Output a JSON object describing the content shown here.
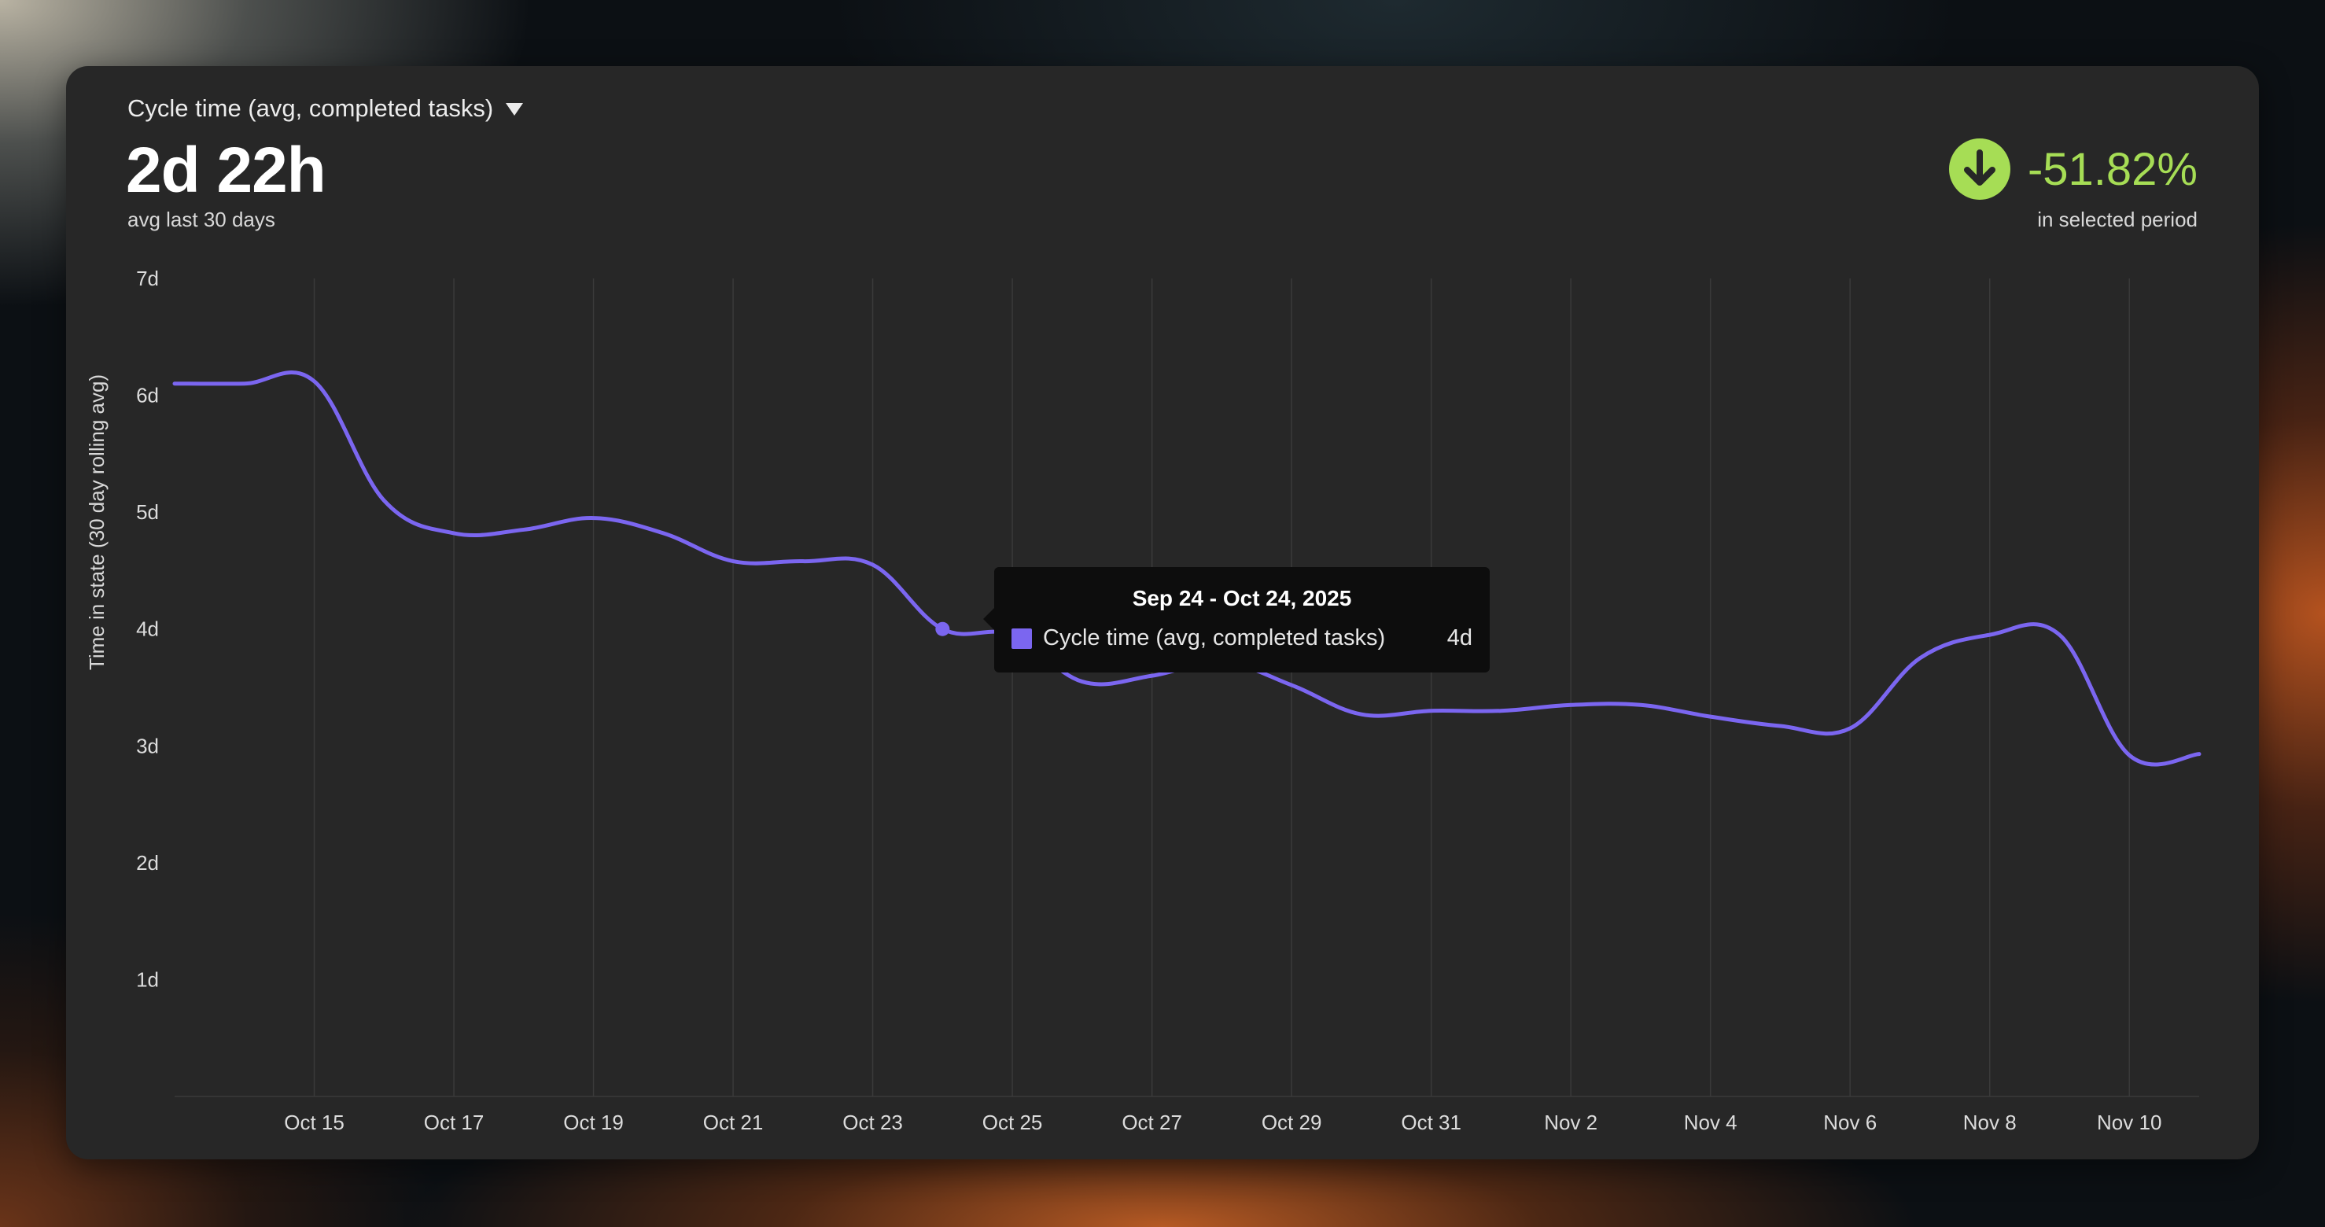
{
  "header": {
    "metric_selector": "Cycle time (avg, completed tasks)",
    "value": "2d 22h",
    "value_caption": "avg last 30 days",
    "change": "-51.82%",
    "change_caption": "in selected period"
  },
  "colors": {
    "series": "#7b66f0",
    "positive_change": "#a6dd55",
    "card_bg": "#272727"
  },
  "icons": {
    "metric_dropdown": "caret-down-icon",
    "change_indicator": "arrow-down-circle-icon"
  },
  "tooltip": {
    "title": "Sep 24 - Oct 24, 2025",
    "series_name": "Cycle time (avg, completed tasks)",
    "value": "4d"
  },
  "chart_data": {
    "type": "line",
    "ylabel": "Time in state (30 day rolling avg)",
    "ylim": [
      0,
      7
    ],
    "y_unit": "days",
    "yticks": [
      1,
      2,
      3,
      4,
      5,
      6,
      7
    ],
    "ytick_labels": [
      "1d",
      "2d",
      "3d",
      "4d",
      "5d",
      "6d",
      "7d"
    ],
    "xlim": [
      "2025-10-14",
      "2025-11-11"
    ],
    "xticks": [
      "2025-10-15",
      "2025-10-17",
      "2025-10-19",
      "2025-10-21",
      "2025-10-23",
      "2025-10-25",
      "2025-10-27",
      "2025-10-29",
      "2025-10-31",
      "2025-11-02",
      "2025-11-04",
      "2025-11-06",
      "2025-11-08",
      "2025-11-10"
    ],
    "xtick_labels": [
      "Oct 15",
      "Oct 17",
      "Oct 19",
      "Oct 21",
      "Oct 23",
      "Oct 25",
      "Oct 27",
      "Oct 29",
      "Oct 31",
      "Nov 2",
      "Nov 4",
      "Nov 6",
      "Nov 8",
      "Nov 10"
    ],
    "grid": "vertical",
    "highlighted_point": {
      "x": "2025-10-24",
      "y": 4.0
    },
    "series": [
      {
        "name": "Cycle time (avg, completed tasks)",
        "x": [
          "2025-10-13",
          "2025-10-14",
          "2025-10-15",
          "2025-10-16",
          "2025-10-17",
          "2025-10-18",
          "2025-10-19",
          "2025-10-20",
          "2025-10-21",
          "2025-10-22",
          "2025-10-23",
          "2025-10-24",
          "2025-10-25",
          "2025-10-26",
          "2025-10-27",
          "2025-10-28",
          "2025-10-29",
          "2025-10-30",
          "2025-10-31",
          "2025-11-01",
          "2025-11-02",
          "2025-11-03",
          "2025-11-04",
          "2025-11-05",
          "2025-11-06",
          "2025-11-07",
          "2025-11-08",
          "2025-11-09",
          "2025-11-10",
          "2025-11-11"
        ],
        "values": [
          6.1,
          6.1,
          6.12,
          5.1,
          4.82,
          4.85,
          4.95,
          4.82,
          4.58,
          4.58,
          4.55,
          4.0,
          3.95,
          3.55,
          3.6,
          3.72,
          3.52,
          3.27,
          3.3,
          3.3,
          3.35,
          3.35,
          3.25,
          3.17,
          3.15,
          3.75,
          3.95,
          3.95,
          2.92,
          2.93
        ]
      }
    ]
  }
}
